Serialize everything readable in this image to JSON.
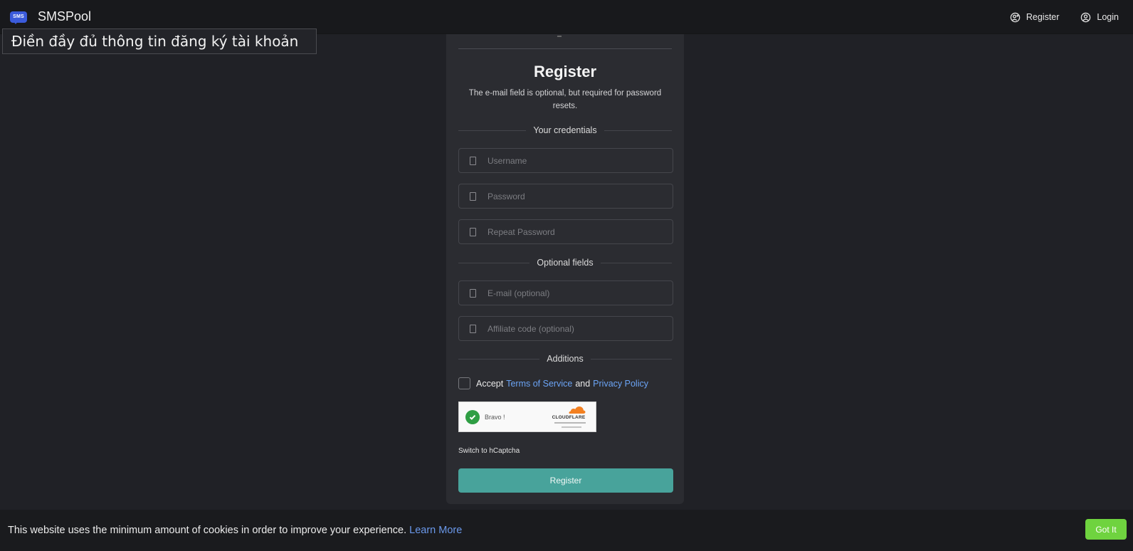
{
  "navbar": {
    "brand_logo_text": "SMS",
    "brand_name": "SMSPool",
    "register_label": "Register",
    "login_label": "Login"
  },
  "caption": "Điền đầy đủ thông tin đăng ký tài khoản",
  "form": {
    "title": "Register",
    "subtitle": "The e-mail field is optional, but required for password resets.",
    "sections": {
      "credentials": "Your credentials",
      "optional": "Optional fields",
      "additions": "Additions"
    },
    "fields": {
      "username_placeholder": "Username",
      "password_placeholder": "Password",
      "repeat_password_placeholder": "Repeat Password",
      "email_placeholder": "E-mail (optional)",
      "affiliate_placeholder": "Affiliate code (optional)"
    },
    "accept": {
      "prefix": "Accept",
      "terms": "Terms of Service",
      "and": "and",
      "privacy": "Privacy Policy"
    },
    "captcha": {
      "status": "Bravo !",
      "provider": "CLOUDFLARE"
    },
    "switch_label": "Switch to hCaptcha",
    "submit_label": "Register"
  },
  "cookie_banner": {
    "text": "This website uses the minimum amount of cookies in order to improve your experience.",
    "learn_more": "Learn More",
    "button": "Got It"
  },
  "colors": {
    "background": "#202126",
    "card": "#2b2c31",
    "accent_teal": "#48a39b",
    "link_blue": "#6ba4f5",
    "got_it_green": "#6fd33f",
    "brand_blue": "#3b5bdb"
  }
}
